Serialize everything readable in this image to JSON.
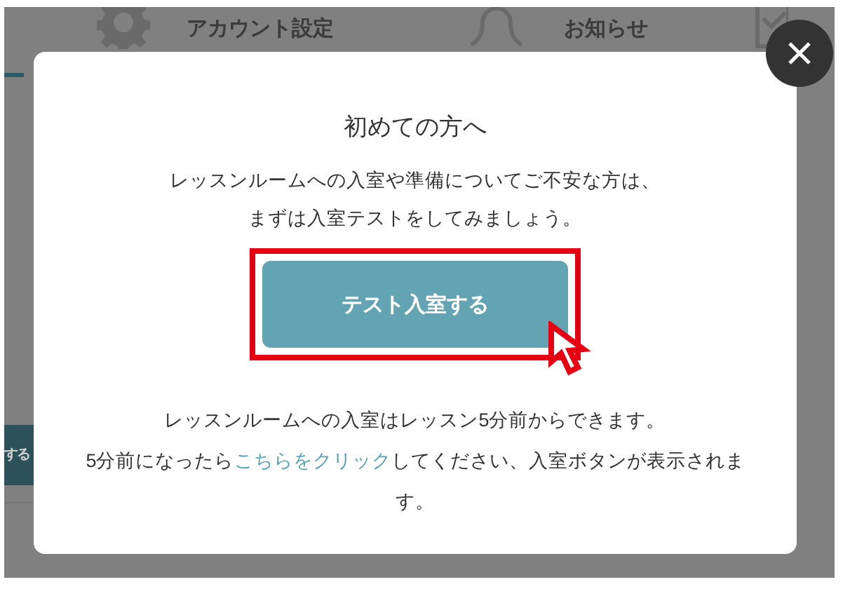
{
  "background": {
    "header_items": [
      {
        "label": "アカウント設定"
      },
      {
        "label": "お知らせ"
      }
    ],
    "side_button": "する"
  },
  "modal": {
    "title": "初めての方へ",
    "intro_lines": [
      "レッスンルームへの入室や準備についてご不安な方は、",
      "まずは入室テストをしてみましょう。"
    ],
    "test_button": {
      "label": "テスト入室する",
      "highlighted": true
    },
    "note_line": "レッスンルームへの入室はレッスン5分前からできます。",
    "note": {
      "before": "5分前になったら",
      "link": "こちらをクリック",
      "after": "してください、入室ボタンが表示されます。"
    }
  }
}
